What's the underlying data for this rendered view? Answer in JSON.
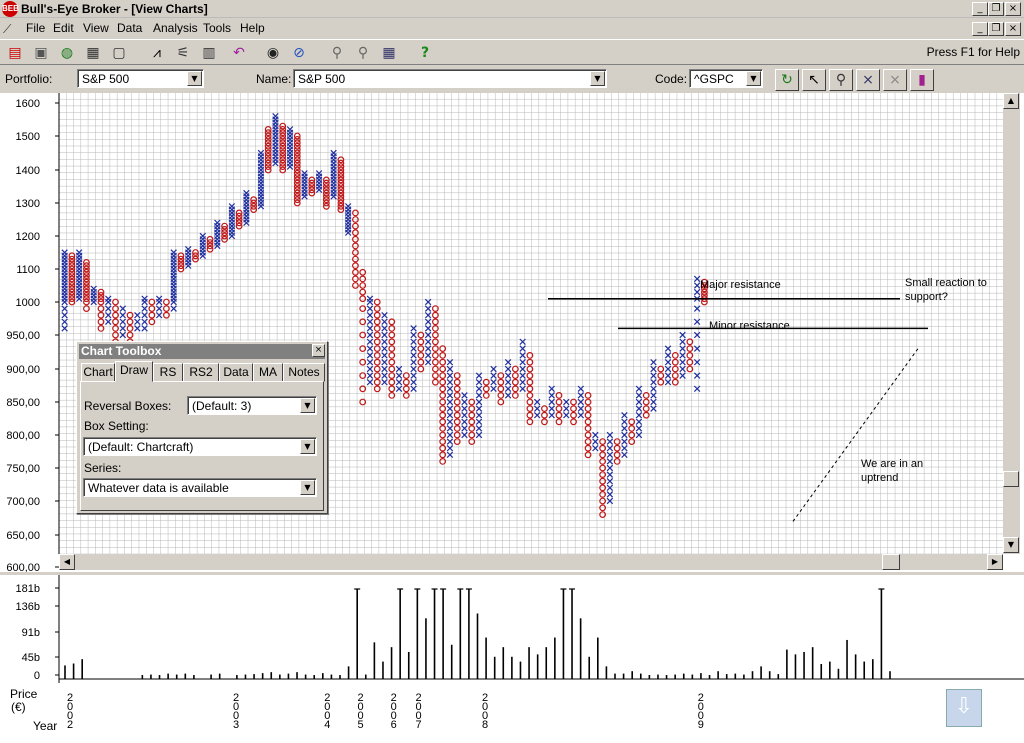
{
  "window": {
    "title": "Bull's-Eye Broker - [View Charts]",
    "icon_glyph": "BEB",
    "minimize": "_",
    "restore": "❐",
    "close": "×"
  },
  "menu": [
    "File",
    "Edit",
    "View",
    "Data",
    "Analysis",
    "Tools",
    "Help"
  ],
  "toolbar": {
    "help_hint": "Press F1 for Help",
    "icons": [
      "new-chart-icon",
      "open-icon",
      "globe-icon",
      "print-icon",
      "print-preview-icon",
      "line-chart-icon",
      "chart-properties-icon",
      "clipboard-icon",
      "undo-icon",
      "eye-icon",
      "cancel-icon",
      "zoom-icon",
      "zoom-out-icon",
      "grid-icon",
      "help-icon"
    ]
  },
  "selectors": {
    "portfolio_label": "Portfolio:",
    "portfolio_value": "S&P 500",
    "name_label": "Name:",
    "name_value": "S&P 500",
    "code_label": "Code:",
    "code_value": "^GSPC",
    "tool_icons": [
      "refresh-icon",
      "pointer-icon",
      "zoom-icon",
      "x-axis-icon",
      "xo-scale-icon",
      "bar-volume-icon"
    ]
  },
  "chart_data": {
    "type": "point-and-figure",
    "y_ticks": [
      "1600",
      "1500",
      "1400",
      "1300",
      "1200",
      "1100",
      "1000",
      "950,00",
      "900,00",
      "850,00",
      "800,00",
      "750,00",
      "700,00",
      "650,00",
      "600,00"
    ],
    "y_tick_values": [
      1600,
      1500,
      1400,
      1300,
      1200,
      1100,
      1000,
      950,
      900,
      850,
      800,
      750,
      700,
      650,
      600
    ],
    "ylim": [
      600,
      1600
    ],
    "grid": true,
    "box_size_hint": 10,
    "reversal": 3,
    "columns": [
      {
        "type": "X",
        "low": 960,
        "high": 1150
      },
      {
        "type": "O",
        "low": 1000,
        "high": 1140
      },
      {
        "type": "X",
        "low": 1010,
        "high": 1150
      },
      {
        "type": "O",
        "low": 990,
        "high": 1120
      },
      {
        "type": "X",
        "low": 1000,
        "high": 1040
      },
      {
        "type": "O",
        "low": 960,
        "high": 1030
      },
      {
        "type": "X",
        "low": 970,
        "high": 1010
      },
      {
        "type": "O",
        "low": 930,
        "high": 1000
      },
      {
        "type": "X",
        "low": 950,
        "high": 990
      },
      {
        "type": "O",
        "low": 930,
        "high": 980
      },
      {
        "type": "X",
        "low": 960,
        "high": 980
      },
      {
        "type": "X",
        "low": 960,
        "high": 1010
      },
      {
        "type": "O",
        "low": 970,
        "high": 1000
      },
      {
        "type": "X",
        "low": 980,
        "high": 1010
      },
      {
        "type": "O",
        "low": 980,
        "high": 1000
      },
      {
        "type": "X",
        "low": 990,
        "high": 1150
      },
      {
        "type": "O",
        "low": 1100,
        "high": 1140
      },
      {
        "type": "X",
        "low": 1110,
        "high": 1160
      },
      {
        "type": "O",
        "low": 1130,
        "high": 1150
      },
      {
        "type": "X",
        "low": 1140,
        "high": 1200
      },
      {
        "type": "O",
        "low": 1160,
        "high": 1190
      },
      {
        "type": "X",
        "low": 1170,
        "high": 1240
      },
      {
        "type": "O",
        "low": 1190,
        "high": 1230
      },
      {
        "type": "X",
        "low": 1200,
        "high": 1290
      },
      {
        "type": "O",
        "low": 1230,
        "high": 1270
      },
      {
        "type": "X",
        "low": 1240,
        "high": 1330
      },
      {
        "type": "O",
        "low": 1280,
        "high": 1310
      },
      {
        "type": "X",
        "low": 1290,
        "high": 1450
      },
      {
        "type": "O",
        "low": 1400,
        "high": 1520
      },
      {
        "type": "X",
        "low": 1420,
        "high": 1560
      },
      {
        "type": "O",
        "low": 1400,
        "high": 1530
      },
      {
        "type": "X",
        "low": 1410,
        "high": 1520
      },
      {
        "type": "O",
        "low": 1300,
        "high": 1500
      },
      {
        "type": "X",
        "low": 1320,
        "high": 1390
      },
      {
        "type": "O",
        "low": 1330,
        "high": 1370
      },
      {
        "type": "X",
        "low": 1340,
        "high": 1390
      },
      {
        "type": "O",
        "low": 1290,
        "high": 1370
      },
      {
        "type": "X",
        "low": 1320,
        "high": 1450
      },
      {
        "type": "O",
        "low": 1280,
        "high": 1430
      },
      {
        "type": "X",
        "low": 1210,
        "high": 1290
      },
      {
        "type": "O",
        "low": 1050,
        "high": 1270
      },
      {
        "type": "O",
        "low": 850,
        "high": 1100
      },
      {
        "type": "X",
        "low": 880,
        "high": 1010
      },
      {
        "type": "O",
        "low": 870,
        "high": 1000
      },
      {
        "type": "X",
        "low": 880,
        "high": 980
      },
      {
        "type": "O",
        "low": 860,
        "high": 970
      },
      {
        "type": "X",
        "low": 870,
        "high": 900
      },
      {
        "type": "O",
        "low": 860,
        "high": 890
      },
      {
        "type": "X",
        "low": 870,
        "high": 960
      },
      {
        "type": "O",
        "low": 900,
        "high": 950
      },
      {
        "type": "X",
        "low": 910,
        "high": 1000
      },
      {
        "type": "O",
        "low": 880,
        "high": 990
      },
      {
        "type": "O",
        "low": 760,
        "high": 930
      },
      {
        "type": "X",
        "low": 770,
        "high": 910
      },
      {
        "type": "O",
        "low": 790,
        "high": 890
      },
      {
        "type": "X",
        "low": 800,
        "high": 860
      },
      {
        "type": "O",
        "low": 790,
        "high": 850
      },
      {
        "type": "X",
        "low": 800,
        "high": 890
      },
      {
        "type": "O",
        "low": 860,
        "high": 880
      },
      {
        "type": "X",
        "low": 870,
        "high": 900
      },
      {
        "type": "O",
        "low": 850,
        "high": 890
      },
      {
        "type": "X",
        "low": 860,
        "high": 910
      },
      {
        "type": "O",
        "low": 860,
        "high": 900
      },
      {
        "type": "X",
        "low": 870,
        "high": 940
      },
      {
        "type": "O",
        "low": 820,
        "high": 920
      },
      {
        "type": "X",
        "low": 830,
        "high": 850
      },
      {
        "type": "O",
        "low": 820,
        "high": 840
      },
      {
        "type": "X",
        "low": 830,
        "high": 870
      },
      {
        "type": "O",
        "low": 820,
        "high": 860
      },
      {
        "type": "X",
        "low": 830,
        "high": 850
      },
      {
        "type": "O",
        "low": 820,
        "high": 850
      },
      {
        "type": "X",
        "low": 830,
        "high": 870
      },
      {
        "type": "O",
        "low": 770,
        "high": 860
      },
      {
        "type": "X",
        "low": 780,
        "high": 800
      },
      {
        "type": "O",
        "low": 680,
        "high": 790
      },
      {
        "type": "X",
        "low": 700,
        "high": 800
      },
      {
        "type": "O",
        "low": 760,
        "high": 790
      },
      {
        "type": "X",
        "low": 770,
        "high": 830
      },
      {
        "type": "O",
        "low": 790,
        "high": 820
      },
      {
        "type": "X",
        "low": 800,
        "high": 870
      },
      {
        "type": "O",
        "low": 830,
        "high": 860
      },
      {
        "type": "X",
        "low": 840,
        "high": 910
      },
      {
        "type": "O",
        "low": 880,
        "high": 900
      },
      {
        "type": "X",
        "low": 880,
        "high": 930
      },
      {
        "type": "O",
        "low": 880,
        "high": 920
      },
      {
        "type": "X",
        "low": 890,
        "high": 950
      },
      {
        "type": "O",
        "low": 900,
        "high": 940
      },
      {
        "type": "X",
        "low": 870,
        "high": 1080
      },
      {
        "type": "O",
        "low": 1000,
        "high": 1060
      }
    ],
    "annotations": [
      {
        "text": "Major resistance",
        "level": 1010
      },
      {
        "text": "Minor resistance",
        "level": 960
      },
      {
        "text": "Small reaction to",
        "level": 1030
      },
      {
        "text": "support?",
        "level": 1010
      },
      {
        "text": "We are in an",
        "level": 760
      },
      {
        "text": "uptrend",
        "level": 740
      }
    ],
    "volume": {
      "y_ticks": [
        "181b",
        "136b",
        "91b",
        "45b",
        "0"
      ],
      "y_tick_values": [
        181,
        136,
        91,
        45,
        0
      ],
      "ylim": [
        0,
        181
      ],
      "values": [
        22,
        26,
        35,
        0,
        0,
        0,
        0,
        0,
        0,
        2,
        3,
        2,
        5,
        3,
        5,
        2,
        0,
        3,
        5,
        0,
        2,
        3,
        4,
        6,
        8,
        3,
        5,
        8,
        3,
        2,
        6,
        3,
        2,
        20,
        181,
        3,
        70,
        30,
        60,
        181,
        50,
        181,
        120,
        181,
        181,
        65,
        181,
        181,
        130,
        80,
        40,
        60,
        40,
        30,
        60,
        45,
        60,
        80,
        181,
        181,
        120,
        40,
        80,
        20,
        5,
        5,
        10,
        5,
        2,
        3,
        2,
        3,
        5,
        3,
        6,
        2,
        10,
        4,
        5,
        3,
        10,
        20,
        10,
        4,
        55,
        45,
        50,
        60,
        25,
        30,
        15,
        75,
        45,
        30,
        35,
        181,
        10
      ],
      "unit": "b"
    },
    "x_axis": {
      "label_top": "Price",
      "label_unit": "(€)",
      "label_bottom": "Year",
      "years": [
        {
          "label": "2002",
          "frac": 0.0
        },
        {
          "label": "2003",
          "frac": 0.2
        },
        {
          "label": "2004",
          "frac": 0.31
        },
        {
          "label": "2005",
          "frac": 0.35
        },
        {
          "label": "2006",
          "frac": 0.39
        },
        {
          "label": "2007",
          "frac": 0.42
        },
        {
          "label": "2008",
          "frac": 0.5
        },
        {
          "label": "2009",
          "frac": 0.76
        }
      ]
    },
    "colors": {
      "x": "#1f2f9f",
      "o": "#c01818",
      "grid": "#b8b8b8",
      "axis": "#000"
    }
  },
  "toolbox": {
    "title": "Chart Toolbox",
    "close": "×",
    "tabs": [
      "Chart",
      "Draw",
      "RS",
      "RS2",
      "Data",
      "MA",
      "Notes"
    ],
    "active_tab": "Draw",
    "reversal_label": "Reversal Boxes:",
    "reversal_value": "(Default: 3)",
    "box_label": "Box Setting:",
    "box_value": "(Default: Chartcraft)",
    "series_label": "Series:",
    "series_value": "Whatever data is available"
  },
  "scroll": {
    "up": "▲",
    "down": "▼",
    "left": "◀",
    "right": "▶"
  },
  "down_button": "⇩"
}
